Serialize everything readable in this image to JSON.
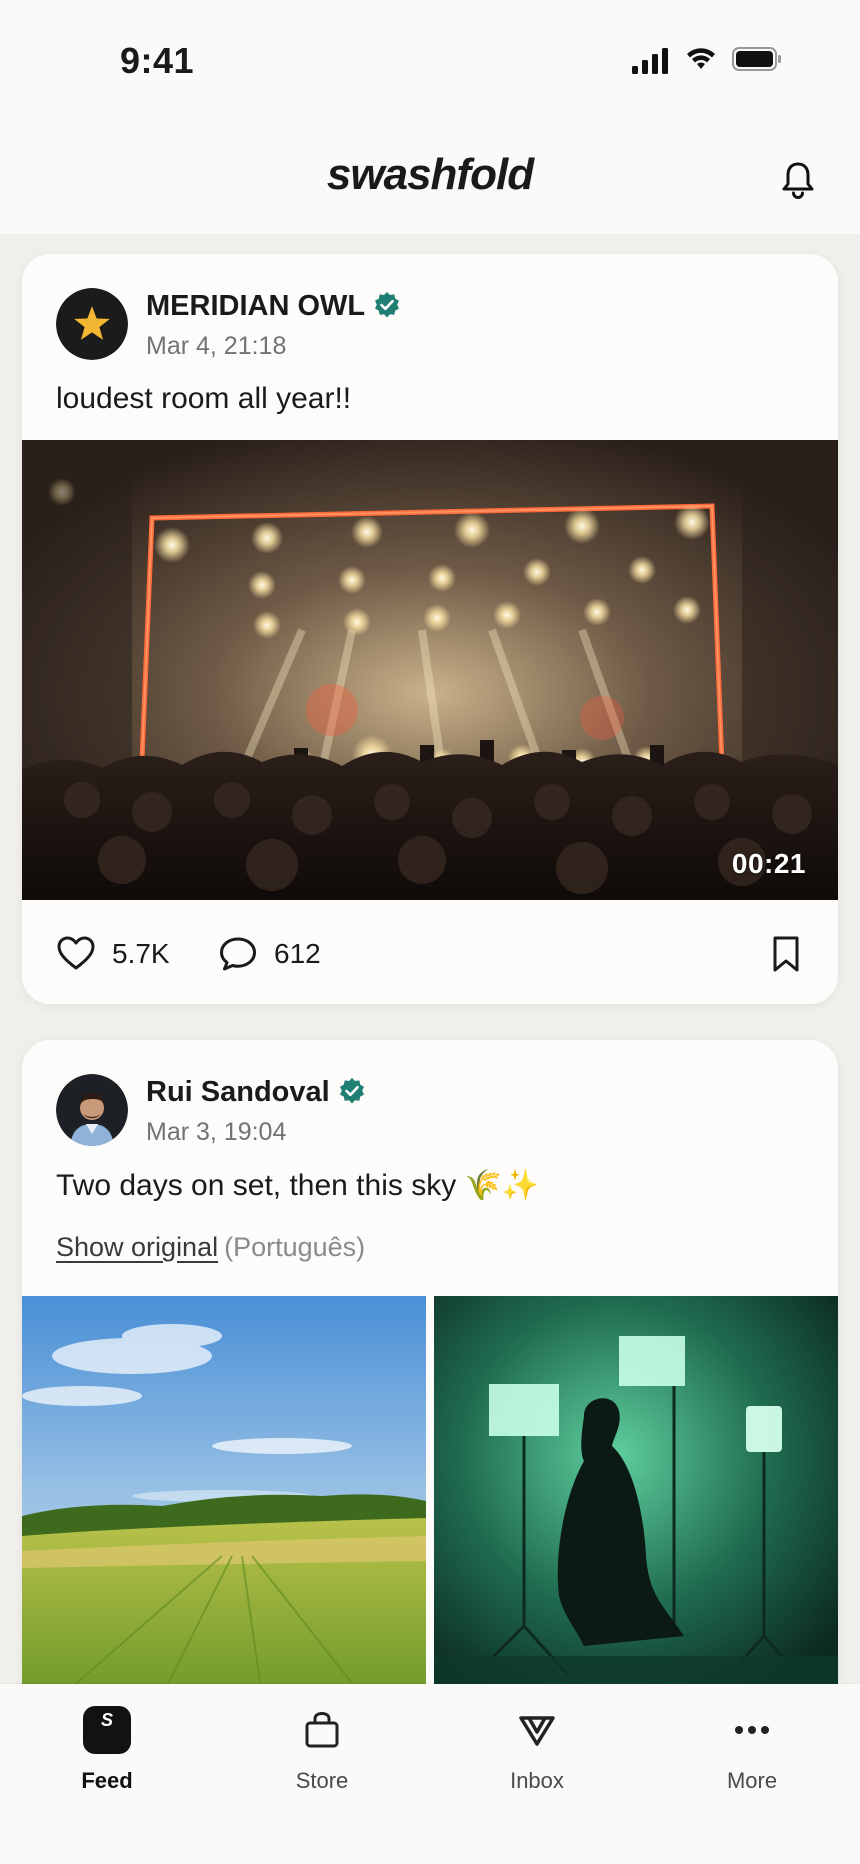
{
  "status": {
    "time": "9:41"
  },
  "app": {
    "logo": "swashfold"
  },
  "posts": [
    {
      "author": "MERIDIAN OWL",
      "date": "Mar 4, 21:18",
      "caption": "loudest room all year!!",
      "duration": "00:21",
      "likes": "5.7K",
      "comments": "612",
      "avatar_icon": "star-icon",
      "verified": true
    },
    {
      "author": "Rui Sandoval",
      "date": "Mar 3, 19:04",
      "caption": "Two days on set, then this sky 🌾✨",
      "show_original": "Show original",
      "language": "(Português)",
      "verified": true
    }
  ],
  "tabs": [
    {
      "label": "Feed",
      "icon": "feed-logo-icon",
      "active": true,
      "badge_letter": "S"
    },
    {
      "label": "Store",
      "icon": "bag-icon"
    },
    {
      "label": "Inbox",
      "icon": "inbox-v-icon"
    },
    {
      "label": "More",
      "icon": "more-dots-icon"
    }
  ],
  "colors": {
    "verified": "#1e7f72",
    "background": "#f0efec",
    "card": "#fdfcfb",
    "text": "#1a1a1a"
  }
}
